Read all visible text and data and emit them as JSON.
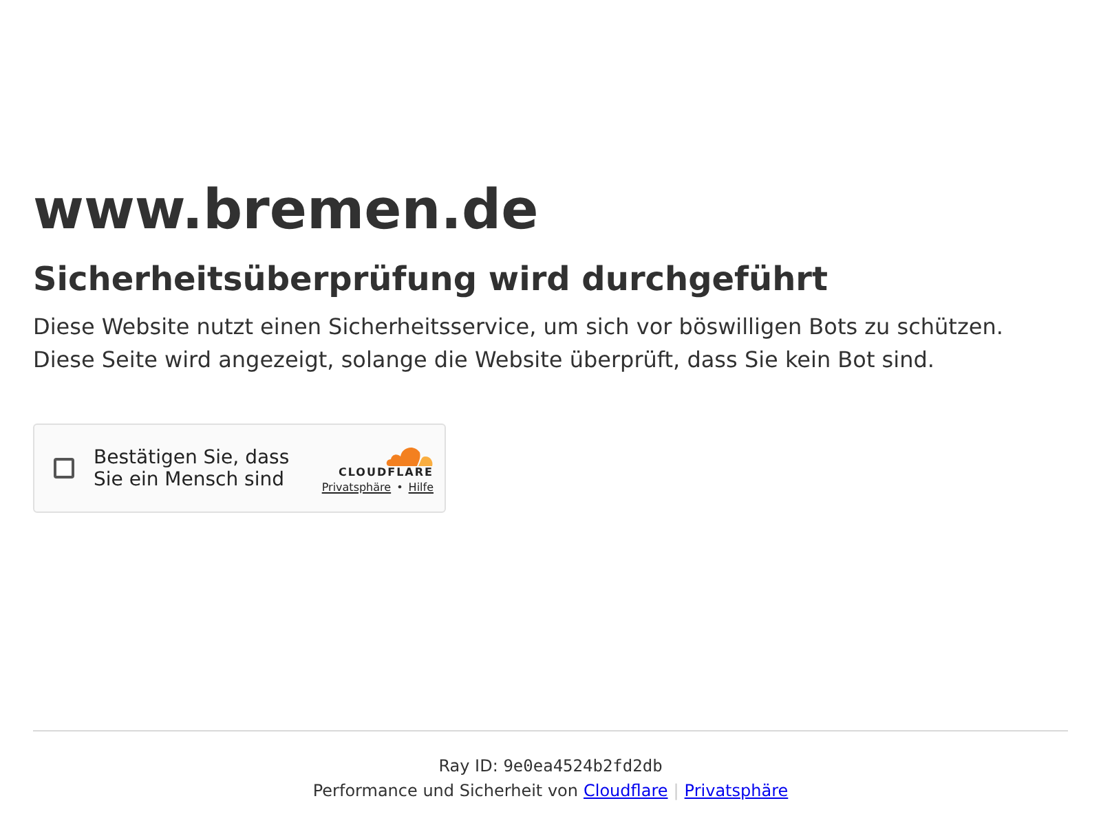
{
  "site": "www.bremen.de",
  "heading": "Sicherheitsüberprüfung wird durchgeführt",
  "paragraphs": [
    "Diese Website nutzt einen Sicherheitsservice, um sich vor böswilligen Bots zu schützen.",
    "Diese Seite wird angezeigt, solange die Website überprüft, dass Sie kein Bot sind."
  ],
  "widget": {
    "checked": false,
    "label": "Bestätigen Sie, dass Sie ein Mensch sind",
    "brand": "CLOUDFLARE",
    "links": [
      "Privatsphäre",
      "Hilfe"
    ],
    "separator": "•"
  },
  "footer": {
    "ray_label": "Ray ID:",
    "ray_id": "9e0ea4524b2fd2db",
    "text": "Performance und Sicherheit von",
    "links": [
      "Cloudflare",
      "Privatsphäre"
    ],
    "separator": "|"
  }
}
